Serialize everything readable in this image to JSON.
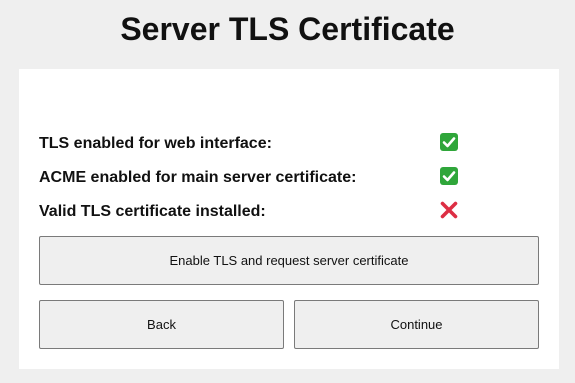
{
  "page": {
    "title": "Server TLS Certificate"
  },
  "status": {
    "items": [
      {
        "label": "TLS enabled for web interface:",
        "state": "ok",
        "icon": "check-mark-icon",
        "color": "#2fa63a"
      },
      {
        "label": "ACME enabled for main server certificate:",
        "state": "ok",
        "icon": "check-mark-icon",
        "color": "#2fa63a"
      },
      {
        "label": "Valid TLS certificate installed:",
        "state": "error",
        "icon": "cross-mark-icon",
        "color": "#dd2e44"
      }
    ]
  },
  "actions": {
    "enable_label": "Enable TLS and request server certificate",
    "back_label": "Back",
    "continue_label": "Continue"
  }
}
